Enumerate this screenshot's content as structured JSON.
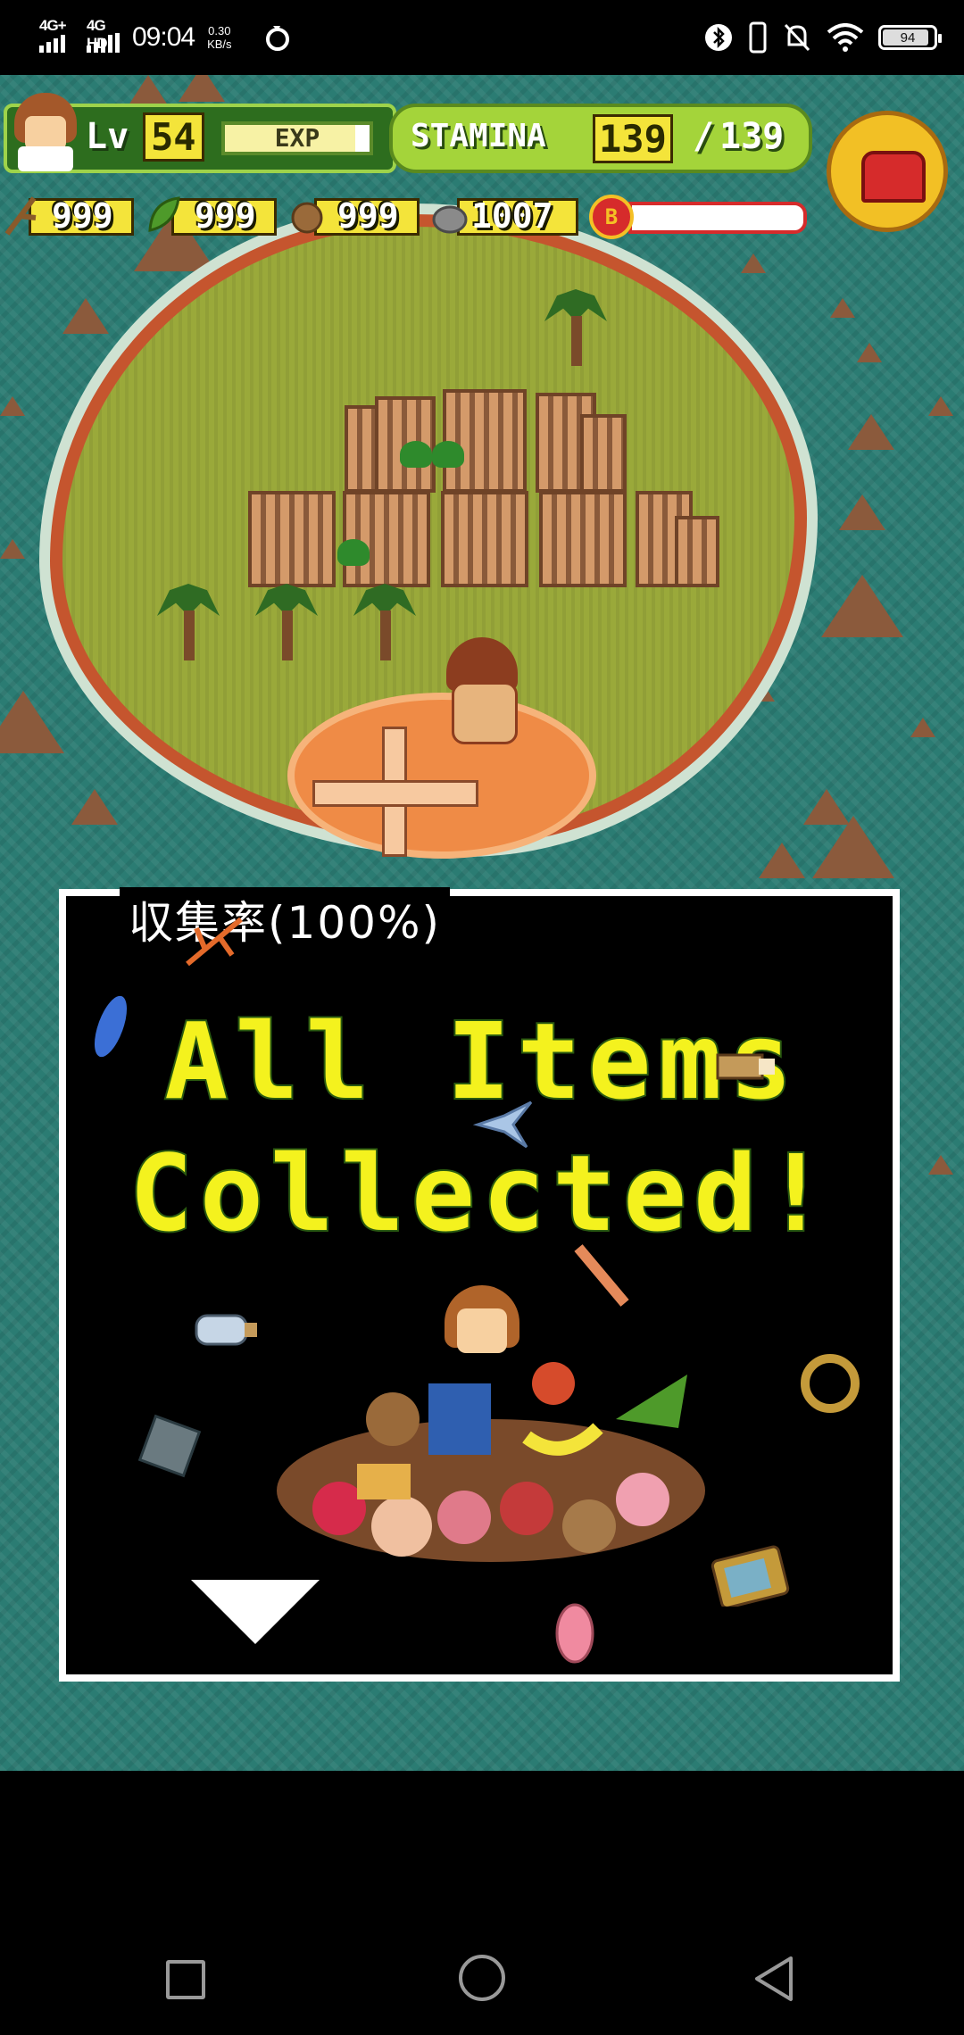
{
  "status_bar": {
    "network_1": "4G+",
    "network_2": "4G HD",
    "time": "09:04",
    "speed_value": "0.30",
    "speed_unit": "KB/s",
    "battery": "94"
  },
  "hud": {
    "level_label": "Lv",
    "level_value": "54",
    "exp_label": "EXP",
    "exp_fraction": 0.9,
    "stamina_label": "STAMINA",
    "stamina_current": "139",
    "stamina_separator": "/",
    "stamina_max": "139",
    "resources": [
      {
        "icon": "branch-icon",
        "value": "999"
      },
      {
        "icon": "leaf-icon",
        "value": "999"
      },
      {
        "icon": "coconut-icon",
        "value": "999"
      },
      {
        "icon": "stone-icon",
        "value": "1007"
      }
    ],
    "boost_label": "B",
    "boost_fraction": 0.0,
    "chest_icon": "treasure-chest-icon"
  },
  "dialog": {
    "collection_rate": "収集率(100%)",
    "headline_line1": "All Items",
    "headline_line2": "Collected!",
    "continue_icon": "down-triangle-icon"
  },
  "colors": {
    "ocean": "#2b7c73",
    "island": "#9aa93a",
    "headline": "#f4f21e",
    "stamina_panel": "#a4d43a"
  }
}
